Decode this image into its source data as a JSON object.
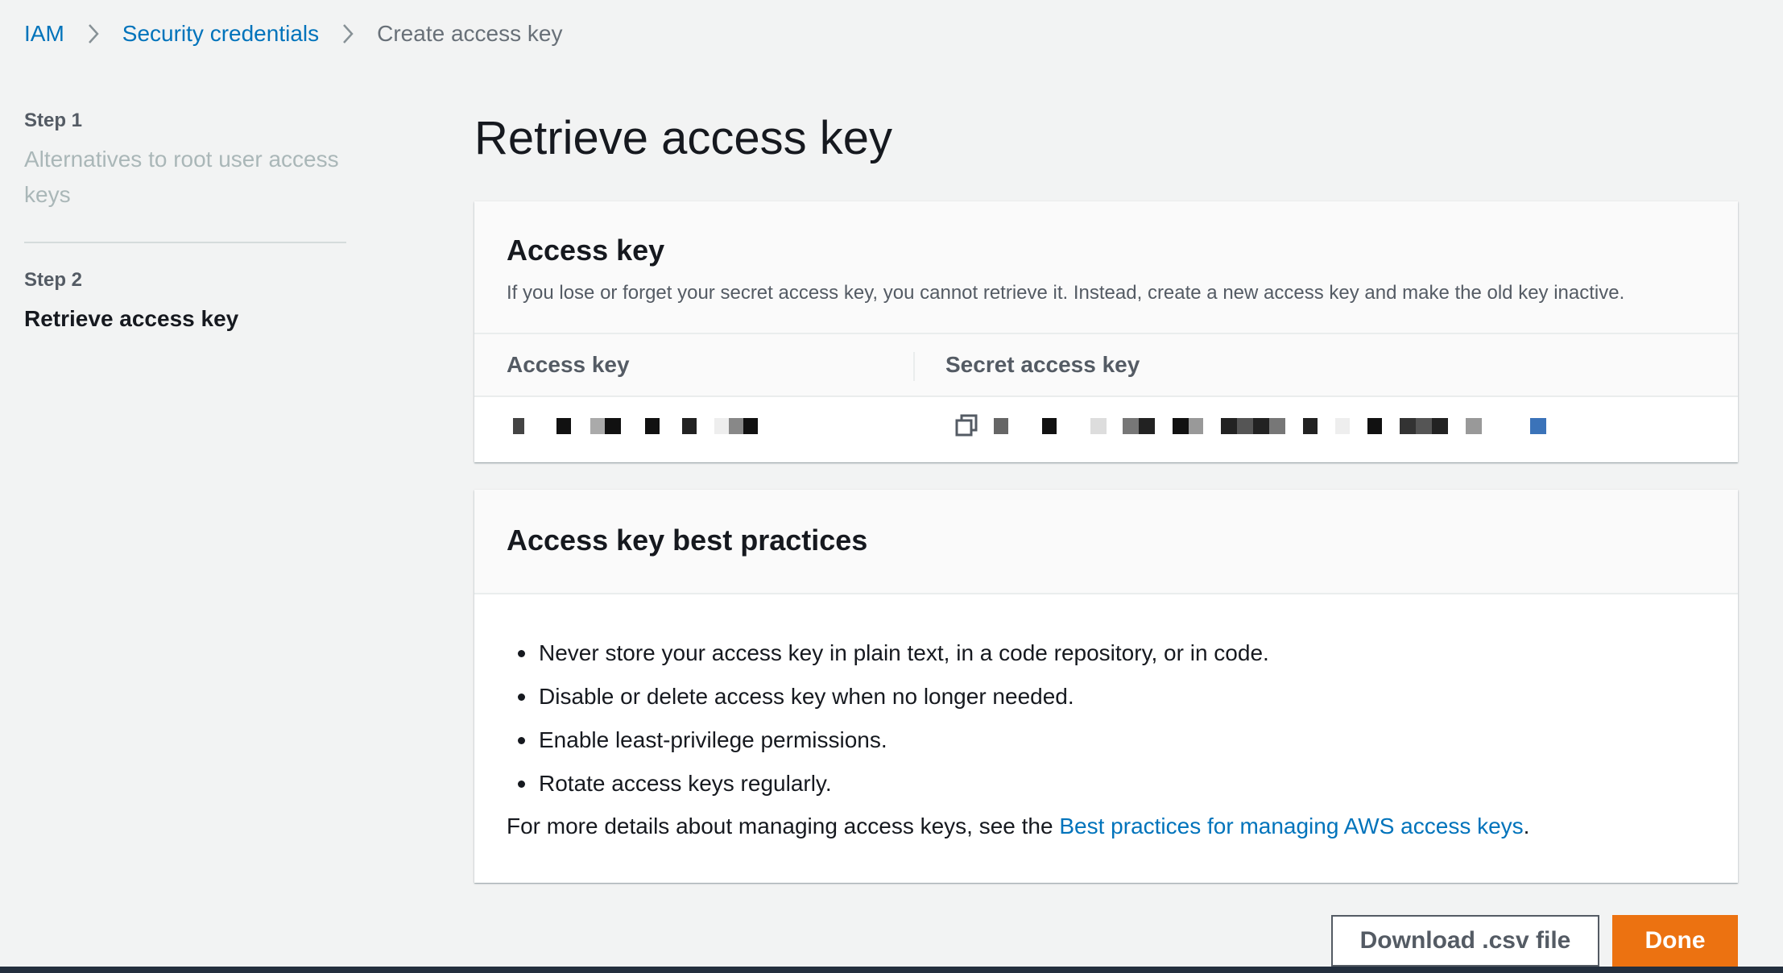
{
  "breadcrumb": {
    "items": [
      {
        "label": "IAM"
      },
      {
        "label": "Security credentials"
      },
      {
        "label": "Create access key"
      }
    ],
    "separator_icon": "chevron-right-icon"
  },
  "steps": [
    {
      "number": "Step 1",
      "title": "Alternatives to root user access keys",
      "active": false
    },
    {
      "number": "Step 2",
      "title": "Retrieve access key",
      "active": true
    }
  ],
  "page_title": "Retrieve access key",
  "access_key_panel": {
    "title": "Access key",
    "description": "If you lose or forget your secret access key, you cannot retrieve it. Instead, create a new access key and make the old key inactive.",
    "columns": {
      "access_key": "Access key",
      "secret_access_key": "Secret access key"
    },
    "copy_icon": "copy-icon"
  },
  "best_practices_panel": {
    "title": "Access key best practices",
    "items": [
      "Never store your access key in plain text, in a code repository, or in code.",
      "Disable or delete access key when no longer needed.",
      "Enable least-privilege permissions.",
      "Rotate access keys regularly."
    ],
    "more_prefix": "For more details about managing access keys, see the ",
    "more_link": "Best practices for managing AWS access keys",
    "more_suffix": "."
  },
  "buttons": {
    "download": "Download .csv file",
    "done": "Done"
  },
  "colors": {
    "link": "#0073bb",
    "primary_button": "#ec7211",
    "background": "#f2f3f3"
  }
}
